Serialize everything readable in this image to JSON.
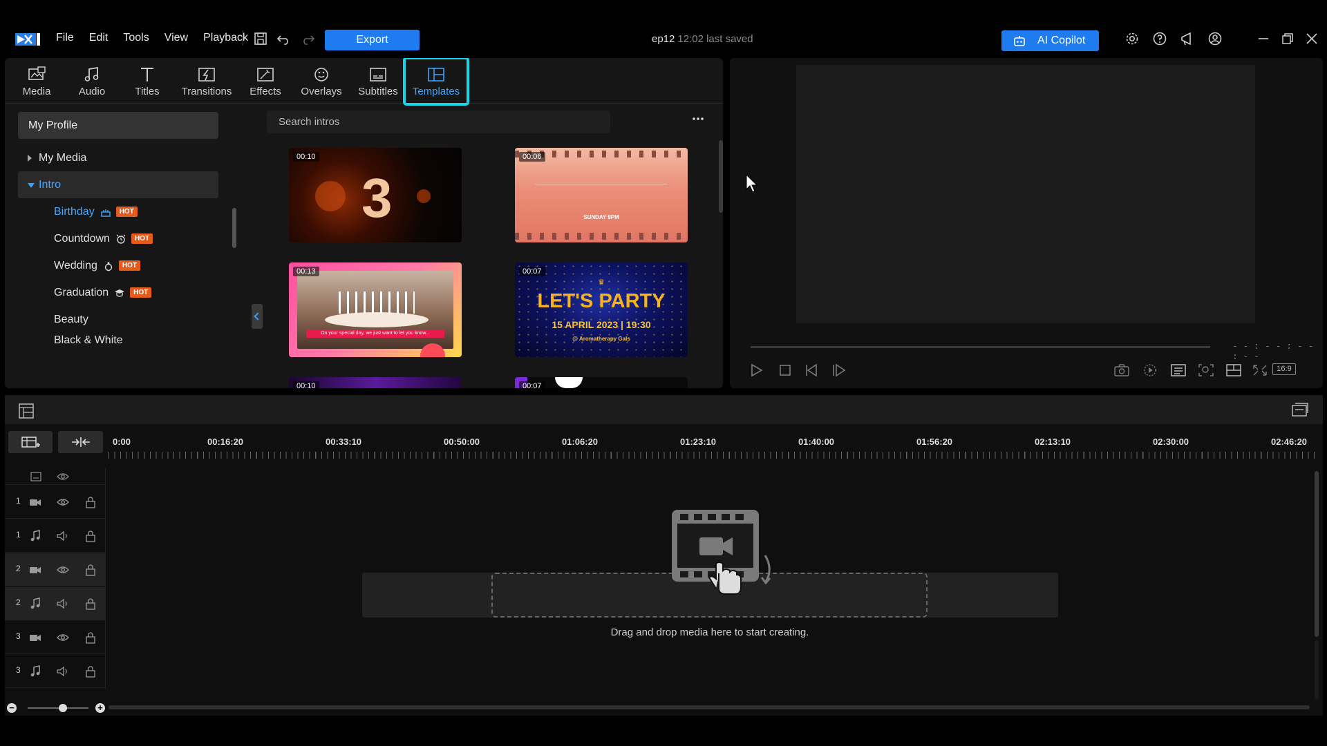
{
  "menu": [
    "File",
    "Edit",
    "Tools",
    "View",
    "Playback"
  ],
  "toolbar": {
    "export_label": "Export",
    "copilot_label": "AI Copilot"
  },
  "project": {
    "name": "ep12",
    "saved": "12:02 last saved"
  },
  "tabs": [
    {
      "label": "Media",
      "icon": "media-icon"
    },
    {
      "label": "Audio",
      "icon": "music-icon"
    },
    {
      "label": "Titles",
      "icon": "text-icon"
    },
    {
      "label": "Transitions",
      "icon": "transition-icon"
    },
    {
      "label": "Effects",
      "icon": "effects-icon"
    },
    {
      "label": "Overlays",
      "icon": "overlay-icon"
    },
    {
      "label": "Subtitles",
      "icon": "subtitle-icon"
    },
    {
      "label": "Templates",
      "icon": "template-icon",
      "active": true
    }
  ],
  "sidebar": {
    "profile": "My Profile",
    "my_media": "My Media",
    "intro": "Intro",
    "items": [
      {
        "label": "Birthday",
        "icon": "cake-icon",
        "badge": "HOT",
        "active": true
      },
      {
        "label": "Countdown",
        "icon": "alarm-clock-icon",
        "badge": "HOT"
      },
      {
        "label": "Wedding",
        "icon": "ring-icon",
        "badge": "HOT"
      },
      {
        "label": "Graduation",
        "icon": "graduation-cap-icon",
        "badge": "HOT"
      },
      {
        "label": "Beauty"
      },
      {
        "label": "Black & White"
      }
    ]
  },
  "search": {
    "placeholder": "Search intros"
  },
  "templates": [
    {
      "duration": "00:10",
      "caption": "3"
    },
    {
      "duration": "00:06",
      "caption": "SUNDAY 9PM"
    },
    {
      "duration": "00:13",
      "caption": "On your special day, we just want to let you know..."
    },
    {
      "duration": "00:07",
      "title": "LET'S PARTY",
      "date": "15 APRIL 2023 | 19:30",
      "venue": "@ Aromatherapy Gals"
    },
    {
      "duration": "00:10"
    },
    {
      "duration": "00:07"
    }
  ],
  "preview": {
    "timecode": "- - : - - : - - : - -",
    "ratio": "16:9"
  },
  "timeline": {
    "ticks": [
      "0:00",
      "00:16:20",
      "00:33:10",
      "00:50:00",
      "01:06:20",
      "01:23:10",
      "01:40:00",
      "01:56:20",
      "02:13:10",
      "02:30:00",
      "02:46:20"
    ],
    "tracks": [
      {
        "num": "1",
        "type": "video"
      },
      {
        "num": "1",
        "type": "audio"
      },
      {
        "num": "2",
        "type": "video"
      },
      {
        "num": "2",
        "type": "audio"
      },
      {
        "num": "3",
        "type": "video"
      },
      {
        "num": "3",
        "type": "audio"
      }
    ],
    "drop_hint": "Drag and drop media here to start creating."
  },
  "colors": {
    "accent": "#1e7cf0",
    "highlight": "#17d4e6",
    "hot": "#e65a1c",
    "active_text": "#4aa6ff"
  }
}
